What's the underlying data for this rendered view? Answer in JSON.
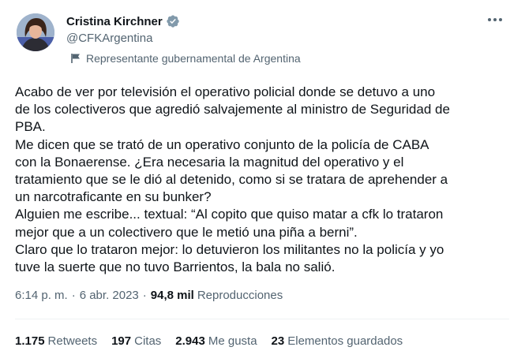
{
  "author": {
    "name": "Cristina Kirchner",
    "handle": "@CFKArgentina",
    "label": "Representante gubernamental de Argentina"
  },
  "tweet": {
    "text": "Acabo de ver por televisión el operativo policial donde se detuvo a uno\nde los colectiveros que agredió salvajemente al ministro de Seguridad de\nPBA.\nMe dicen que se trató de un operativo conjunto de la policía de CABA\ncon la Bonaerense. ¿Era necesaria la magnitud del operativo y el\ntratamiento que se le dió al detenido, como si se tratara de aprehender a\nun narcotraficante en su bunker?\nAlguien me escribe... textual: “Al copito que quiso matar a cfk lo trataron\nmejor que a un colectivero que le metió una piña a berni”.\nClaro que lo trataron mejor: lo detuvieron los militantes no la policía y yo\ntuve la suerte que no tuvo Barrientos, la bala no salió."
  },
  "meta": {
    "time": "6:14 p. m.",
    "separator": "·",
    "date": "6 abr. 2023",
    "views_count": "94,8 mil",
    "views_label": "Reproducciones"
  },
  "stats": {
    "retweets_count": "1.175",
    "retweets_label": "Retweets",
    "quotes_count": "197",
    "quotes_label": "Citas",
    "likes_count": "2.943",
    "likes_label": "Me gusta",
    "bookmarks_count": "23",
    "bookmarks_label": "Elementos guardados"
  },
  "colors": {
    "text_primary": "#0f1419",
    "text_secondary": "#536471",
    "verified_gray": "#829aab",
    "divider": "#eff3f4"
  },
  "icons": {
    "verified": "verified-badge-icon",
    "label": "flag-icon",
    "more": "more-horizontal-icon"
  }
}
